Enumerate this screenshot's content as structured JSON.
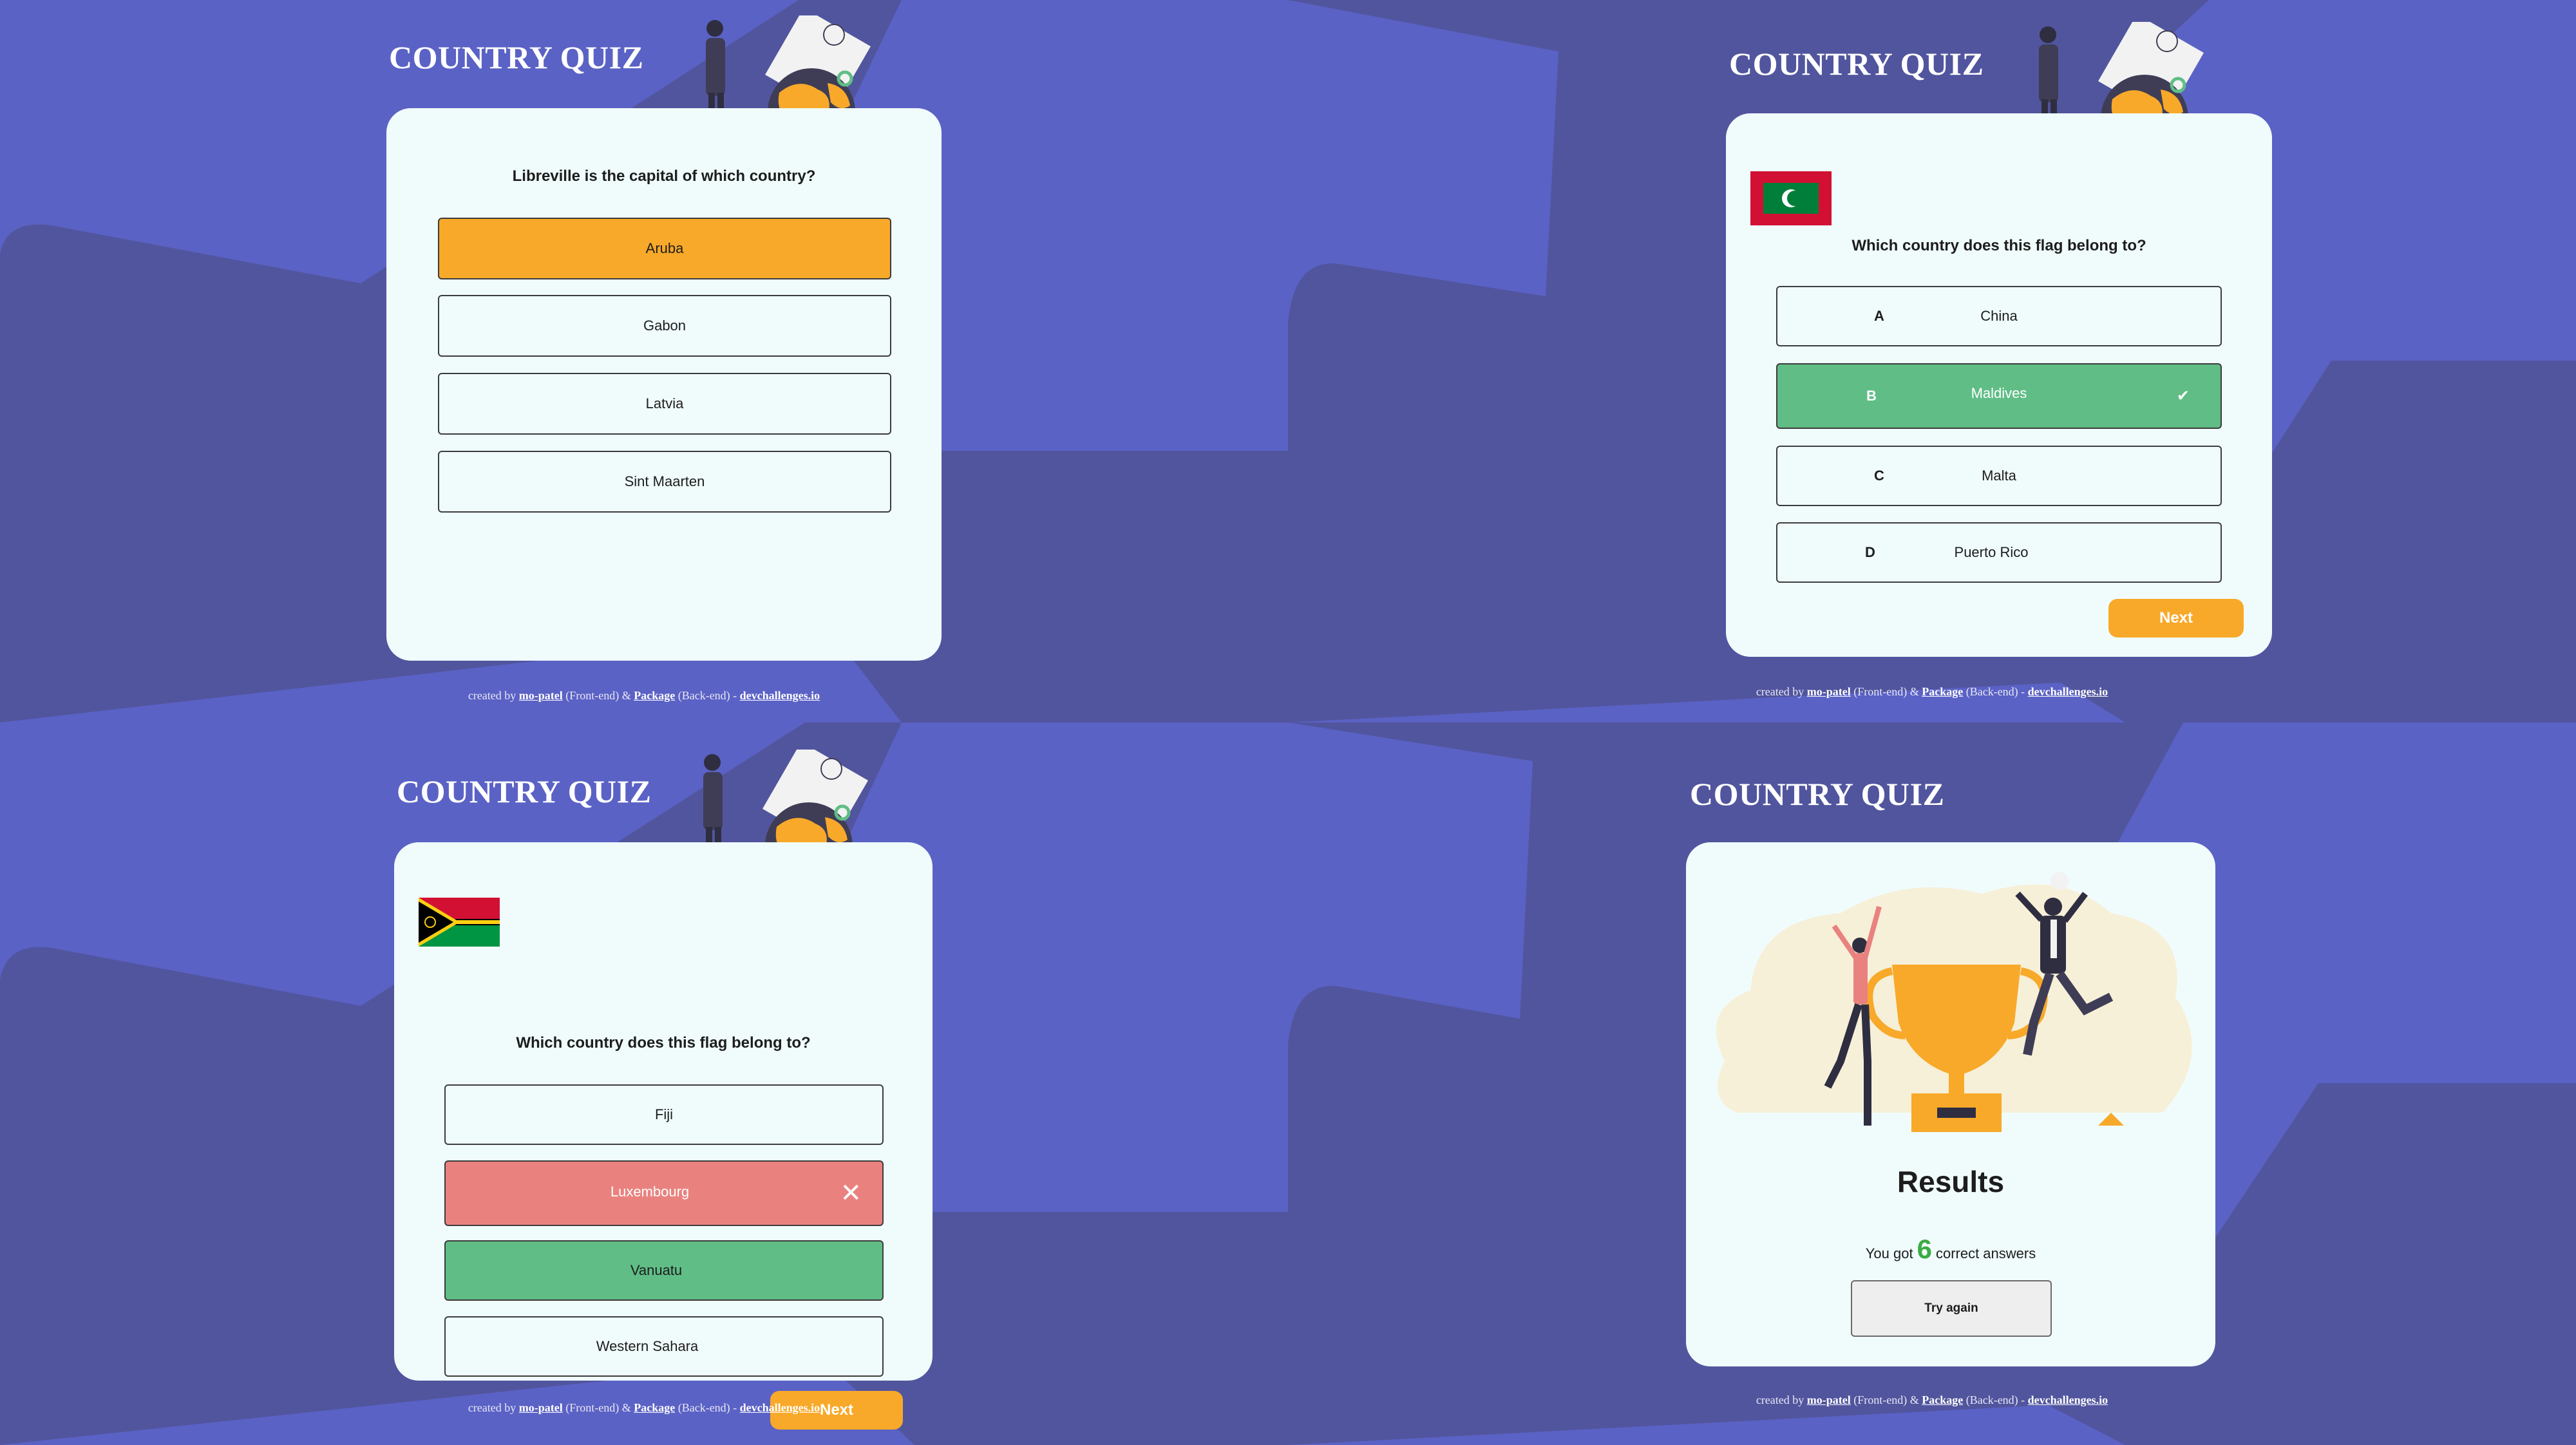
{
  "app_title": "COUNTRY QUIZ",
  "footer": {
    "created_by": "created by",
    "author1": "mo-patel",
    "role1": "(Front-end) &",
    "author2": "Package",
    "role2": "(Back-end) -",
    "site": "devchallenges.io"
  },
  "panels": {
    "capital_question": {
      "question": "Libreville is the capital of which country?",
      "options": [
        {
          "label": "Aruba",
          "state": "selected"
        },
        {
          "label": "Gabon",
          "state": "default"
        },
        {
          "label": "Latvia",
          "state": "default"
        },
        {
          "label": "Sint Maarten",
          "state": "default"
        }
      ]
    },
    "flag_question_correct": {
      "flag": "maldives-flag",
      "question": "Which country does this flag belong to?",
      "options": [
        {
          "letter": "A",
          "label": "China",
          "state": "default"
        },
        {
          "letter": "B",
          "label": "Maldives",
          "state": "correct",
          "mark": "✔"
        },
        {
          "letter": "C",
          "label": "Malta",
          "state": "default"
        },
        {
          "letter": "D",
          "label": "Puerto Rico",
          "state": "default"
        }
      ],
      "next_label": "Next"
    },
    "flag_question_wrong": {
      "flag": "vanuatu-flag",
      "question": "Which country does this flag belong to?",
      "options": [
        {
          "label": "Fiji",
          "state": "default"
        },
        {
          "label": "Luxembourg",
          "state": "wrong",
          "mark": "✕"
        },
        {
          "label": "Vanuatu",
          "state": "correct"
        },
        {
          "label": "Western Sahara",
          "state": "default"
        }
      ],
      "next_label": "Next"
    },
    "results": {
      "title": "Results",
      "prefix": "You got",
      "score": "6",
      "suffix": "correct answers",
      "try_again_label": "Try again"
    }
  },
  "colors": {
    "background": "#5b62c5",
    "background_dark": "#51559e",
    "card": "#f0fcfc",
    "accent_orange": "#f8a92a",
    "correct_green": "#60bd86",
    "wrong_red": "#e9827f",
    "score_green": "#3cab44"
  }
}
